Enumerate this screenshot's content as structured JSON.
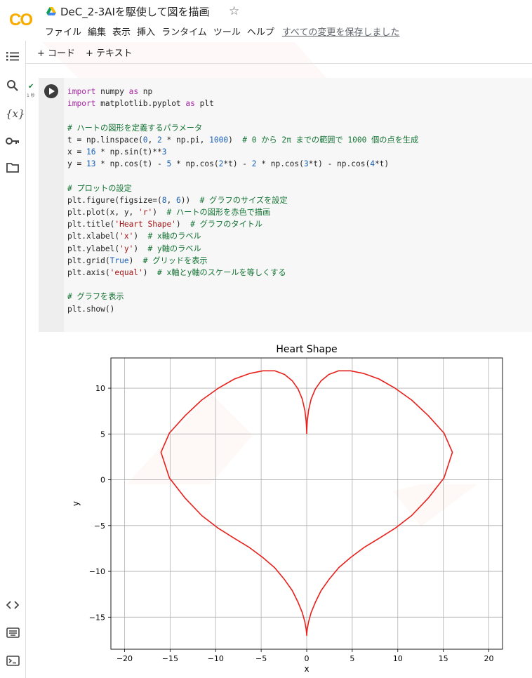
{
  "app": {
    "title": "DeC_2-3AIを駆使して図を描画",
    "logo_text": "CO",
    "menu": [
      "ファイル",
      "編集",
      "表示",
      "挿入",
      "ランタイム",
      "ツール",
      "ヘルプ"
    ],
    "save_status": "すべての変更を保存しました"
  },
  "toolbar": {
    "add_code": "+ コード",
    "add_text": "+ テキスト"
  },
  "cell": {
    "exec_time": "1 秒",
    "lines": [
      [
        [
          "k",
          "import"
        ],
        [
          "p",
          " numpy "
        ],
        [
          "k",
          "as"
        ],
        [
          "p",
          " np"
        ]
      ],
      [
        [
          "k",
          "import"
        ],
        [
          "p",
          " matplotlib.pyplot "
        ],
        [
          "k",
          "as"
        ],
        [
          "p",
          " plt"
        ]
      ],
      [
        [
          "p",
          ""
        ]
      ],
      [
        [
          "c",
          "# ハートの図形を定義するパラメータ"
        ]
      ],
      [
        [
          "p",
          "t = np.linspace("
        ],
        [
          "n",
          "0"
        ],
        [
          "p",
          ", "
        ],
        [
          "n",
          "2"
        ],
        [
          "p",
          " * np.pi, "
        ],
        [
          "n",
          "1000"
        ],
        [
          "p",
          ")  "
        ],
        [
          "c",
          "# 0 から 2π までの範囲で 1000 個の点を生成"
        ]
      ],
      [
        [
          "p",
          "x = "
        ],
        [
          "n",
          "16"
        ],
        [
          "p",
          " * np.sin(t)**"
        ],
        [
          "n",
          "3"
        ]
      ],
      [
        [
          "p",
          "y = "
        ],
        [
          "n",
          "13"
        ],
        [
          "p",
          " * np.cos(t) - "
        ],
        [
          "n",
          "5"
        ],
        [
          "p",
          " * np.cos("
        ],
        [
          "n",
          "2"
        ],
        [
          "p",
          "*t) - "
        ],
        [
          "n",
          "2"
        ],
        [
          "p",
          " * np.cos("
        ],
        [
          "n",
          "3"
        ],
        [
          "p",
          "*t) - np.cos("
        ],
        [
          "n",
          "4"
        ],
        [
          "p",
          "*t)"
        ]
      ],
      [
        [
          "p",
          ""
        ]
      ],
      [
        [
          "c",
          "# プロットの設定"
        ]
      ],
      [
        [
          "p",
          "plt.figure(figsize=("
        ],
        [
          "n",
          "8"
        ],
        [
          "p",
          ", "
        ],
        [
          "n",
          "6"
        ],
        [
          "p",
          "))  "
        ],
        [
          "c",
          "# グラフのサイズを設定"
        ]
      ],
      [
        [
          "p",
          "plt.plot(x, y, "
        ],
        [
          "s",
          "'r'"
        ],
        [
          "p",
          ")  "
        ],
        [
          "c",
          "# ハートの図形を赤色で描画"
        ]
      ],
      [
        [
          "p",
          "plt.title("
        ],
        [
          "s",
          "'Heart Shape'"
        ],
        [
          "p",
          ")  "
        ],
        [
          "c",
          "# グラフのタイトル"
        ]
      ],
      [
        [
          "p",
          "plt.xlabel("
        ],
        [
          "s",
          "'x'"
        ],
        [
          "p",
          ")  "
        ],
        [
          "c",
          "# x軸のラベル"
        ]
      ],
      [
        [
          "p",
          "plt.ylabel("
        ],
        [
          "s",
          "'y'"
        ],
        [
          "p",
          ")  "
        ],
        [
          "c",
          "# y軸のラベル"
        ]
      ],
      [
        [
          "p",
          "plt.grid("
        ],
        [
          "n",
          "True"
        ],
        [
          "p",
          ")  "
        ],
        [
          "c",
          "# グリッドを表示"
        ]
      ],
      [
        [
          "p",
          "plt.axis("
        ],
        [
          "s",
          "'equal'"
        ],
        [
          "p",
          ")  "
        ],
        [
          "c",
          "# x軸とy軸のスケールを等しくする"
        ]
      ],
      [
        [
          "p",
          ""
        ]
      ],
      [
        [
          "c",
          "# グラフを表示"
        ]
      ],
      [
        [
          "p",
          "plt.show()"
        ]
      ]
    ]
  },
  "chart_data": {
    "type": "line",
    "title": "Heart Shape",
    "xlabel": "x",
    "ylabel": "y",
    "xlim": [
      -21.5,
      21.5
    ],
    "ylim": [
      -18.5,
      13.3
    ],
    "xticks": [
      -20,
      -15,
      -10,
      -5,
      0,
      5,
      10,
      15,
      20
    ],
    "yticks": [
      -15,
      -10,
      -5,
      0,
      5,
      10
    ],
    "grid": true,
    "series": [
      {
        "color": "#e8201b",
        "x": [
          0,
          0.0078,
          0.0624,
          0.2091,
          0.4891,
          0.9375,
          1.5812,
          2.4375,
          3.5124,
          4.8012,
          6.2863,
          7.9354,
          9.7036,
          11.5312,
          13.3498,
          15.0733,
          16.0,
          15.0733,
          13.3498,
          11.5312,
          9.7036,
          7.9354,
          6.2863,
          4.8012,
          3.5124,
          2.4375,
          1.5812,
          0.9375,
          0.4891,
          0.2091,
          0.0624,
          0.0078,
          0,
          -0.0078,
          -0.0624,
          -0.2091,
          -0.4891,
          -0.9375,
          -1.5812,
          -2.4375,
          -3.5124,
          -4.8012,
          -6.2863,
          -7.9354,
          -9.7036,
          -11.5312,
          -13.3498,
          -15.0733,
          -16.0,
          -15.0733,
          -13.3498,
          -11.5312,
          -9.7036,
          -7.9354,
          -6.2863,
          -4.8012,
          -3.5124,
          -2.4375,
          -1.5812,
          -0.9375,
          -0.4891,
          -0.2091,
          -0.0624,
          -0.0078,
          0
        ],
        "y": [
          5,
          5.4,
          6.4,
          7.6,
          8.8,
          9.9,
          10.8,
          11.5,
          11.9,
          11.9,
          11.6,
          11.0,
          10.0,
          8.7,
          7.0,
          5.1,
          3.0,
          0.2,
          -2.0,
          -3.9,
          -5.3,
          -6.4,
          -7.4,
          -8.5,
          -9.6,
          -10.9,
          -12.1,
          -13.4,
          -14.5,
          -15.5,
          -16.3,
          -16.8,
          -17,
          -16.8,
          -16.3,
          -15.5,
          -14.5,
          -13.4,
          -12.1,
          -10.9,
          -9.6,
          -8.5,
          -7.4,
          -6.4,
          -5.3,
          -3.9,
          -2.0,
          0.2,
          3.0,
          5.1,
          7.0,
          8.7,
          10.0,
          11.0,
          11.6,
          11.9,
          11.9,
          11.5,
          10.8,
          9.9,
          8.8,
          7.6,
          6.4,
          5.4,
          5
        ]
      }
    ]
  }
}
